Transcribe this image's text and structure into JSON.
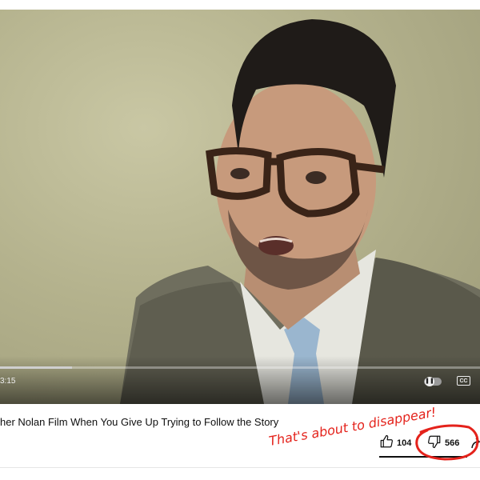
{
  "player": {
    "time": "3:15",
    "progress_fraction": 0.15,
    "cc_label": "CC",
    "autoplay_symbol": "❚❚"
  },
  "video": {
    "title": "her Nolan Film When You Give Up Trying to Follow the Story"
  },
  "actions": {
    "like_count": "104",
    "dislike_count": "566",
    "like_icon": "thumbs-up-icon",
    "dislike_icon": "thumbs-down-icon",
    "share_icon": "share-icon"
  },
  "annotation": {
    "text": "That's about to disappear!",
    "color": "#e4221b"
  }
}
